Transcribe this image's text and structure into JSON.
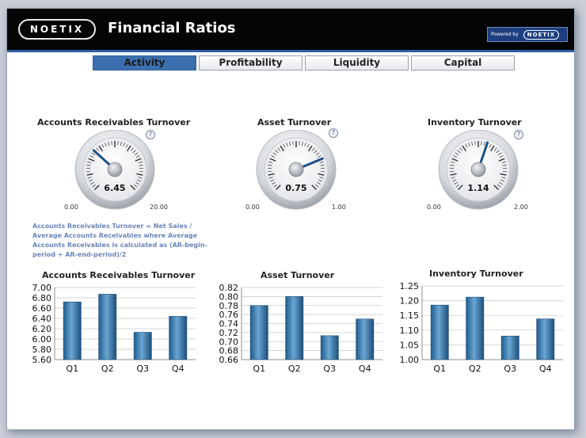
{
  "header": {
    "logo_text": "NOETIX",
    "title": "Financial Ratios",
    "powered_by": "Powered by",
    "powered_name": "NOETIX"
  },
  "tabs": [
    {
      "label": "Activity",
      "active": true
    },
    {
      "label": "Profitability",
      "active": false
    },
    {
      "label": "Liquidity",
      "active": false
    },
    {
      "label": "Capital",
      "active": false
    }
  ],
  "gauges": [
    {
      "title": "Accounts Receivables Turnover",
      "value": 6.45,
      "value_label": "6.45",
      "min": 0,
      "max": 20,
      "min_label": "0.00",
      "max_label": "20.00"
    },
    {
      "title": "Asset Turnover",
      "value": 0.75,
      "value_label": "0.75",
      "min": 0,
      "max": 1,
      "min_label": "0.00",
      "max_label": "1.00"
    },
    {
      "title": "Inventory Turnover",
      "value": 1.14,
      "value_label": "1.14",
      "min": 0,
      "max": 2,
      "min_label": "0.00",
      "max_label": "2.00"
    }
  ],
  "help_label": "?",
  "formula_text": "Accounts Receivables Turnover = Net Sales / Average Accounts Receivables where Average Accounts Receivables is calculated as (AR-begin-period + AR-end-period)/2",
  "colors": {
    "bar": "#3f80b2",
    "accent": "#2e5fa6",
    "needle": "#1f4f86"
  },
  "chart_data": [
    {
      "type": "bar",
      "title": "Accounts Receivables Turnover",
      "categories": [
        "Q1",
        "Q2",
        "Q3",
        "Q4"
      ],
      "values": [
        6.72,
        6.87,
        6.13,
        6.44
      ],
      "ylim": [
        5.6,
        7.0
      ],
      "yticks": [
        5.6,
        5.8,
        6.0,
        6.2,
        6.4,
        6.6,
        6.8,
        7.0
      ],
      "ytick_labels": [
        "5.60",
        "5.80",
        "6.00",
        "6.20",
        "6.40",
        "6.60",
        "6.80",
        "7.00"
      ],
      "grid": true
    },
    {
      "type": "bar",
      "title": "Asset Turnover",
      "categories": [
        "Q1",
        "Q2",
        "Q3",
        "Q4"
      ],
      "values": [
        0.78,
        0.8,
        0.713,
        0.75
      ],
      "ylim": [
        0.66,
        0.82
      ],
      "yticks": [
        0.66,
        0.68,
        0.7,
        0.72,
        0.74,
        0.76,
        0.78,
        0.8,
        0.82
      ],
      "ytick_labels": [
        "0.66",
        "0.68",
        "0.70",
        "0.72",
        "0.74",
        "0.76",
        "0.78",
        "0.80",
        "0.82"
      ],
      "grid": true
    },
    {
      "type": "bar",
      "title": "Inventory Turnover",
      "categories": [
        "Q1",
        "Q2",
        "Q3",
        "Q4"
      ],
      "values": [
        1.185,
        1.212,
        1.08,
        1.138
      ],
      "ylim": [
        1.0,
        1.25
      ],
      "yticks": [
        1.0,
        1.05,
        1.1,
        1.15,
        1.2,
        1.25
      ],
      "ytick_labels": [
        "1.00",
        "1.05",
        "1.10",
        "1.15",
        "1.20",
        "1.25"
      ],
      "grid": true
    }
  ]
}
